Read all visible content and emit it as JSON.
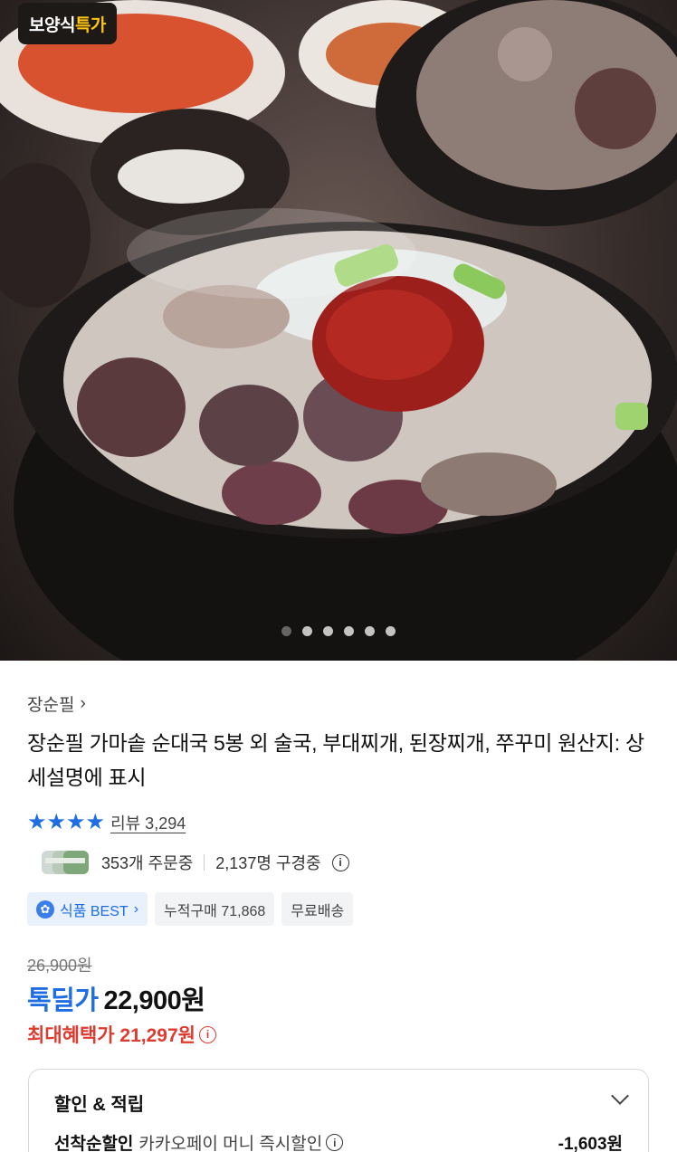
{
  "hero": {
    "badge_white": "보양식",
    "badge_yellow": "특가",
    "slide_count": 6,
    "active_slide": 1
  },
  "product": {
    "brand": "장순필",
    "title": "장순필 가마솥 순대국 5봉 외 술국, 부대찌개, 된장찌개, 쭈꾸미 원산지: 상세설명에 표시",
    "rating_stars": 4,
    "review_label": "리뷰 3,294",
    "orders": "353개 주문중",
    "viewers": "2,137명 구경중"
  },
  "tags": {
    "best": "식품 BEST",
    "cumulative": "누적구매 71,868",
    "shipping": "무료배송"
  },
  "price": {
    "original": "26,900원",
    "deal_label": "톡딜가",
    "deal_price": "22,900원",
    "max_benefit": "최대혜택가 21,297원"
  },
  "discount": {
    "title": "할인 & 적립",
    "row_label": "선착순할인",
    "row_desc": "카카오페이 머니 즉시할인",
    "row_amount": "-1,603원"
  },
  "colors": {
    "accent_blue": "#1e6de3",
    "benefit_red": "#e03a2e",
    "badge_yellow": "#ffc414"
  }
}
